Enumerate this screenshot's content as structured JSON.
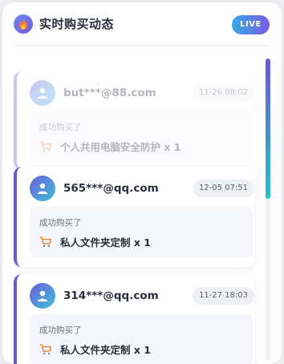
{
  "header": {
    "title": "实时购买动态",
    "badge": "LIVE",
    "icon": "flame-icon"
  },
  "feed": {
    "items": [
      {
        "email": "but***@88.com",
        "time": "11-26 08:02",
        "action_label": "成功购买了",
        "product": "个人共用电脑安全防护 x 1",
        "faded": true
      },
      {
        "email": "565***@qq.com",
        "time": "12-05 07:51",
        "action_label": "成功购买了",
        "product": "私人文件夹定制 x 1",
        "faded": false
      },
      {
        "email": "314***@qq.com",
        "time": "11-27 18:03",
        "action_label": "成功购买了",
        "product": "私人文件夹定制 x 1",
        "faded": false
      }
    ]
  },
  "colors": {
    "accent": "#6a5ad6",
    "live_badge_start": "#3aa9e8",
    "live_badge_end": "#7b5ae0",
    "scroll_thumb_end": "#25c2c9"
  }
}
